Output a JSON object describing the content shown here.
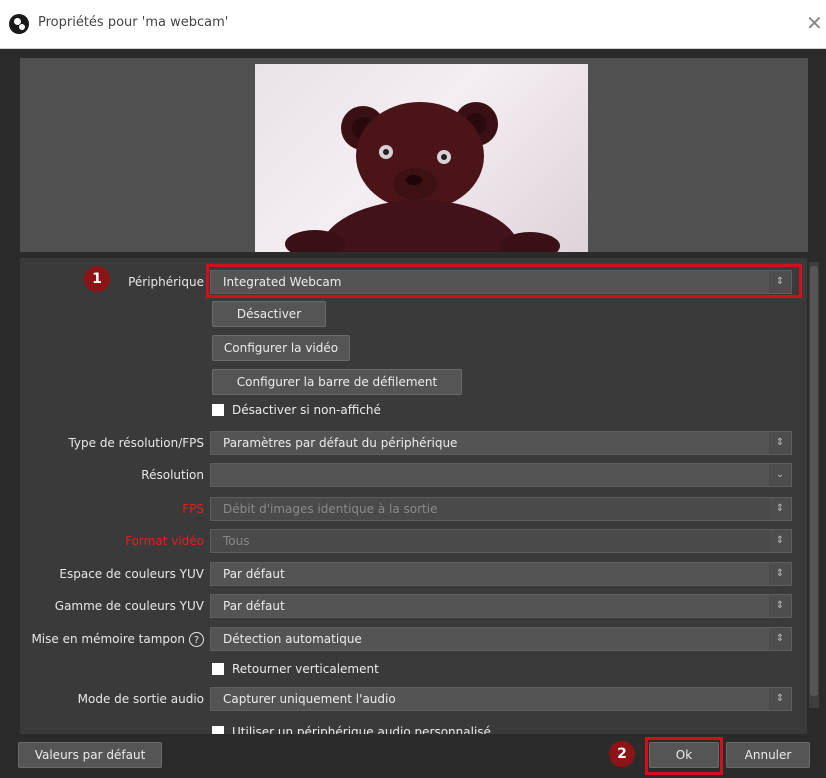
{
  "window": {
    "title": "Propriétés pour 'ma webcam'",
    "close_icon": "close-icon",
    "app_icon": "obs-logo-icon"
  },
  "properties": {
    "device": {
      "label": "Périphérique",
      "value": "Integrated Webcam"
    },
    "buttons": {
      "deactivate": "Désactiver",
      "configure_video": "Configurer la vidéo",
      "configure_crossbar": "Configurer la barre de défilement"
    },
    "deactivate_when_hidden": "Désactiver si non-affiché",
    "res_fps_type": {
      "label": "Type de résolution/FPS",
      "value": "Paramètres par défaut du périphérique"
    },
    "resolution": {
      "label": "Résolution",
      "value": ""
    },
    "fps": {
      "label": "FPS",
      "value": "Débit d'images identique à la sortie"
    },
    "video_format": {
      "label": "Format vidéo",
      "value": "Tous"
    },
    "yuv_space": {
      "label": "Espace de couleurs YUV",
      "value": "Par défaut"
    },
    "yuv_range": {
      "label": "Gamme de couleurs YUV",
      "value": "Par défaut"
    },
    "buffering": {
      "label": "Mise en mémoire tampon",
      "value": "Détection automatique"
    },
    "flip_vertical": "Retourner verticalement",
    "audio_mode": {
      "label": "Mode de sortie audio",
      "value": "Capturer uniquement l'audio"
    },
    "custom_audio": "Utiliser un périphérique audio personnalisé"
  },
  "footer": {
    "defaults": "Valeurs par défaut",
    "ok": "Ok",
    "cancel": "Annuler"
  },
  "annotations": {
    "badge1": "1",
    "badge2": "2",
    "color": "#d2101b"
  }
}
